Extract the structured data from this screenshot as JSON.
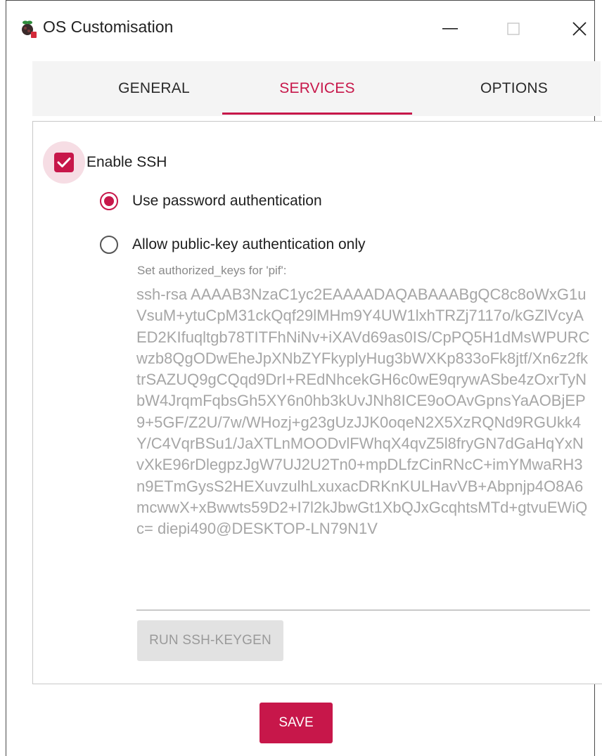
{
  "window": {
    "title": "OS Customisation",
    "app_icon": "raspberry-pi-icon",
    "controls": [
      "minimize-icon",
      "maximize-icon",
      "close-icon"
    ]
  },
  "tabs": [
    {
      "label": "GENERAL",
      "active": false
    },
    {
      "label": "SERVICES",
      "active": true
    },
    {
      "label": "OPTIONS",
      "active": false
    }
  ],
  "services": {
    "enable_ssh": {
      "label": "Enable SSH",
      "checked": true
    },
    "auth_options": [
      {
        "label": "Use password authentication",
        "selected": true
      },
      {
        "label": "Allow public-key authentication only",
        "selected": false
      }
    ],
    "authorized_keys_caption": "Set authorized_keys for 'pif':",
    "authorized_keys_value": "ssh-rsa AAAAB3NzaC1yc2EAAAADAQABAAABgQC8c8oWxG1uVsuM+ytuCpM31ckQqf29lMHm9Y4UW1lxhTRZj7117o/kGZlVcyAED2KIfuqltgb78TITFhNiNv+iXAVd69as0IS/CpPQ5H1dMsWPURCwzb8QgODwEheJpXNbZYFkyplyHug3bWXKp833oFk8jtf/Xn6z2fktrSAZUQ9gCQqd9DrI+REdNhcekGH6c0wE9qrywASbe4zOxrTyNbW4JrqmFqbsGh5XY6n0hb3kUvJNh8ICE9oOAvGpnsYaAOBjEP9+5GF/Z2U/7w/WHozj+g23gUzJJK0oqeN2X5XzRQNd9RGUkk4Y/C4VqrBSu1/JaXTLnMOODvlFWhqX4qvZ5l8fryGN7dGaHqYxNvXkE96rDlegpzJgW7UJ2U2Tn0+mpDLfzCinRNcC+imYMwaRH3n9ETmGysS2HEXuvzulhLxuxacDRKnKULHavVB+Abpnjp4O8A6mcwwX+xBwwts59D2+I7l2kJbwGt1XbQJxGcqhtsMTd+gtvuEWiQc= diepi490@DESKTOP-LN79N1V",
    "keygen_button": "RUN SSH-KEYGEN"
  },
  "footer": {
    "save_button": "SAVE"
  },
  "colors": {
    "accent": "#c7174a",
    "accent_tint": "#f6dde4",
    "disabled_text": "#a6a6a6",
    "tab_bar_bg": "#f4f4f4"
  }
}
